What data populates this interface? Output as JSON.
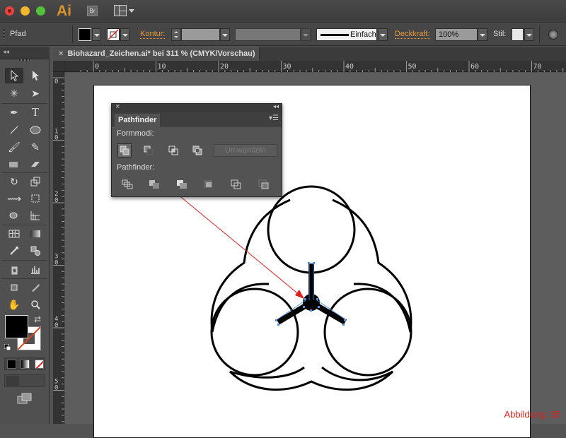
{
  "app": {
    "logo": "Ai",
    "bridge_label": "Br",
    "window_controls": [
      "close",
      "minimize",
      "zoom"
    ]
  },
  "control_bar": {
    "selection_type": "Pfad",
    "fill_color": "#000000",
    "stroke_swatch": "none",
    "kontur_label": "Kontur:",
    "kontur_value": "",
    "stroke_profile": "Einfach",
    "opacity_label": "Deckkraft:",
    "opacity_value": "100%",
    "style_label": "Stil:"
  },
  "document": {
    "tab_title": "Biohazard_Zeichen.ai* bei 311 % (CMYK/Vorschau)",
    "close_glyph": "×"
  },
  "rulers": {
    "horizontal": [
      "0",
      "10",
      "20",
      "30",
      "40",
      "50",
      "60",
      "70"
    ],
    "vertical": [
      "0",
      "1\n0",
      "2\n0",
      "3\n0",
      "4\n0",
      "5\n0"
    ]
  },
  "tools": [
    "selection-tool",
    "direct-selection-tool",
    "magic-wand-tool",
    "lasso-tool",
    "pen-tool",
    "type-tool",
    "line-tool",
    "ellipse-tool",
    "paintbrush-tool",
    "pencil-tool",
    "blob-brush-tool",
    "eraser-tool",
    "rotate-tool",
    "scale-tool",
    "width-tool",
    "free-transform-tool",
    "shape-builder-tool",
    "perspective-grid-tool",
    "mesh-tool",
    "gradient-tool",
    "eyedropper-tool",
    "blend-tool",
    "symbol-sprayer-tool",
    "column-graph-tool",
    "artboard-tool",
    "slice-tool",
    "hand-tool",
    "zoom-tool"
  ],
  "pathfinder_panel": {
    "title": "Pathfinder",
    "formmodi_label": "Formmodi:",
    "pathfinder_label": "Pathfinder:",
    "convert_button": "Umwandeln",
    "shape_modes": [
      "Vereinen",
      "Vorderes Objekt abziehen",
      "Schnittmenge bilden",
      "Überlappungsbereich ausschließen"
    ],
    "pathfinders": [
      "Fläche aufteilen",
      "Überlappung entfernen",
      "Verdeckte Fläche entfernen",
      "Schnittmengenfläche",
      "Kontur aufteilen",
      "Hinteres Objekt abziehen"
    ],
    "selected_mode": "Vereinen"
  },
  "annotation": {
    "figure_label": "Abbildung: 35",
    "arrow_color": "#e0201c"
  },
  "colors": {
    "accent_orange": "#e69a3c",
    "selection_blue": "#4a90e2"
  }
}
